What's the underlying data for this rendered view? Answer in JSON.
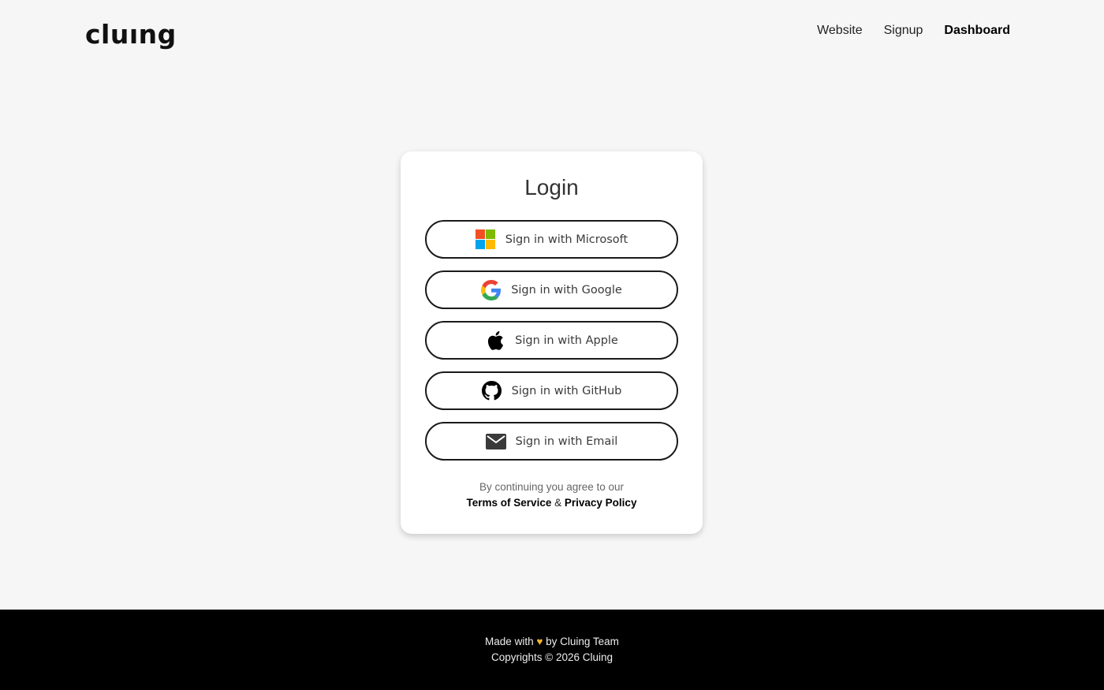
{
  "header": {
    "logo": "cluıng",
    "nav": [
      "Website",
      "Signup",
      "Dashboard"
    ],
    "active_nav": "Dashboard"
  },
  "login": {
    "title": "Login",
    "buttons": [
      {
        "label": "Sign in with Microsoft",
        "icon": "microsoft-icon"
      },
      {
        "label": "Sign in with Google",
        "icon": "google-icon"
      },
      {
        "label": "Sign in with Apple",
        "icon": "apple-icon"
      },
      {
        "label": "Sign in with GitHub",
        "icon": "github-icon"
      },
      {
        "label": "Sign in with Email",
        "icon": "email-icon"
      }
    ],
    "agree_text": "By continuing you agree to our",
    "terms_label": "Terms of Service",
    "ampersand": "&",
    "privacy_label": "Privacy Policy"
  },
  "footer": {
    "made_with": "Made with",
    "by_team": "by Cluing Team",
    "copyright": "Copyrights © 2026 Cluing"
  },
  "colors": {
    "background": "#f6f6f6",
    "card": "#ffffff",
    "footer": "#000000",
    "heart": "#f2b431"
  }
}
